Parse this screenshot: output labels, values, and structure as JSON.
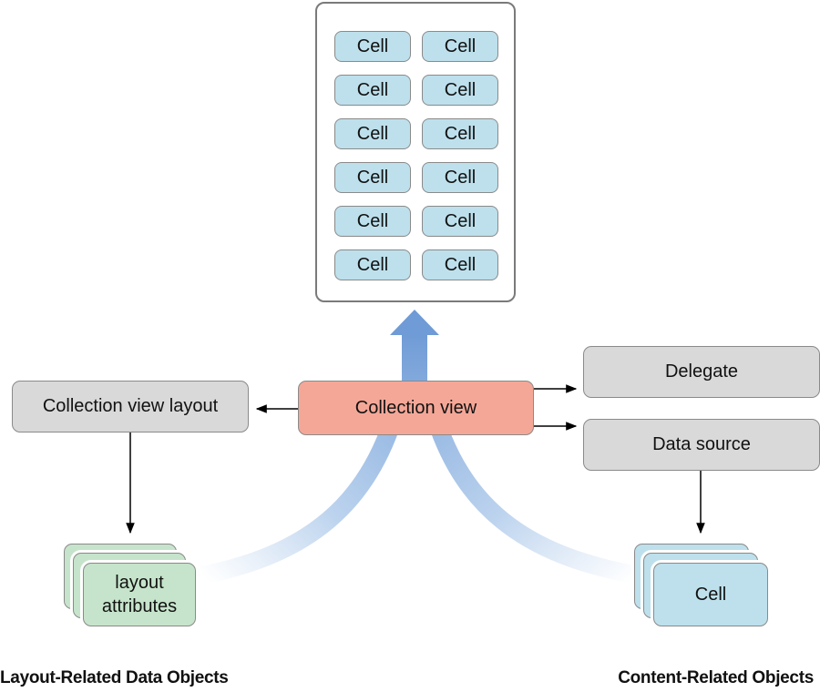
{
  "diagram": {
    "collection_view_display": {
      "cells": [
        "Cell",
        "Cell",
        "Cell",
        "Cell",
        "Cell",
        "Cell",
        "Cell",
        "Cell",
        "Cell",
        "Cell",
        "Cell",
        "Cell"
      ]
    },
    "nodes": {
      "collection_view": "Collection view",
      "collection_view_layout": "Collection view layout",
      "delegate": "Delegate",
      "data_source": "Data source",
      "layout_attributes": "layout\nattributes",
      "cell": "Cell"
    },
    "captions": {
      "left": "Layout-Related Data Objects",
      "right": "Content-Related Objects"
    },
    "colors": {
      "collection_view": "#f5a797",
      "gray_node": "#d9d9d9",
      "layout_attributes": "#c6e4cb",
      "cell": "#bde0ec",
      "flow_arrow": "#7fa8d9"
    }
  }
}
